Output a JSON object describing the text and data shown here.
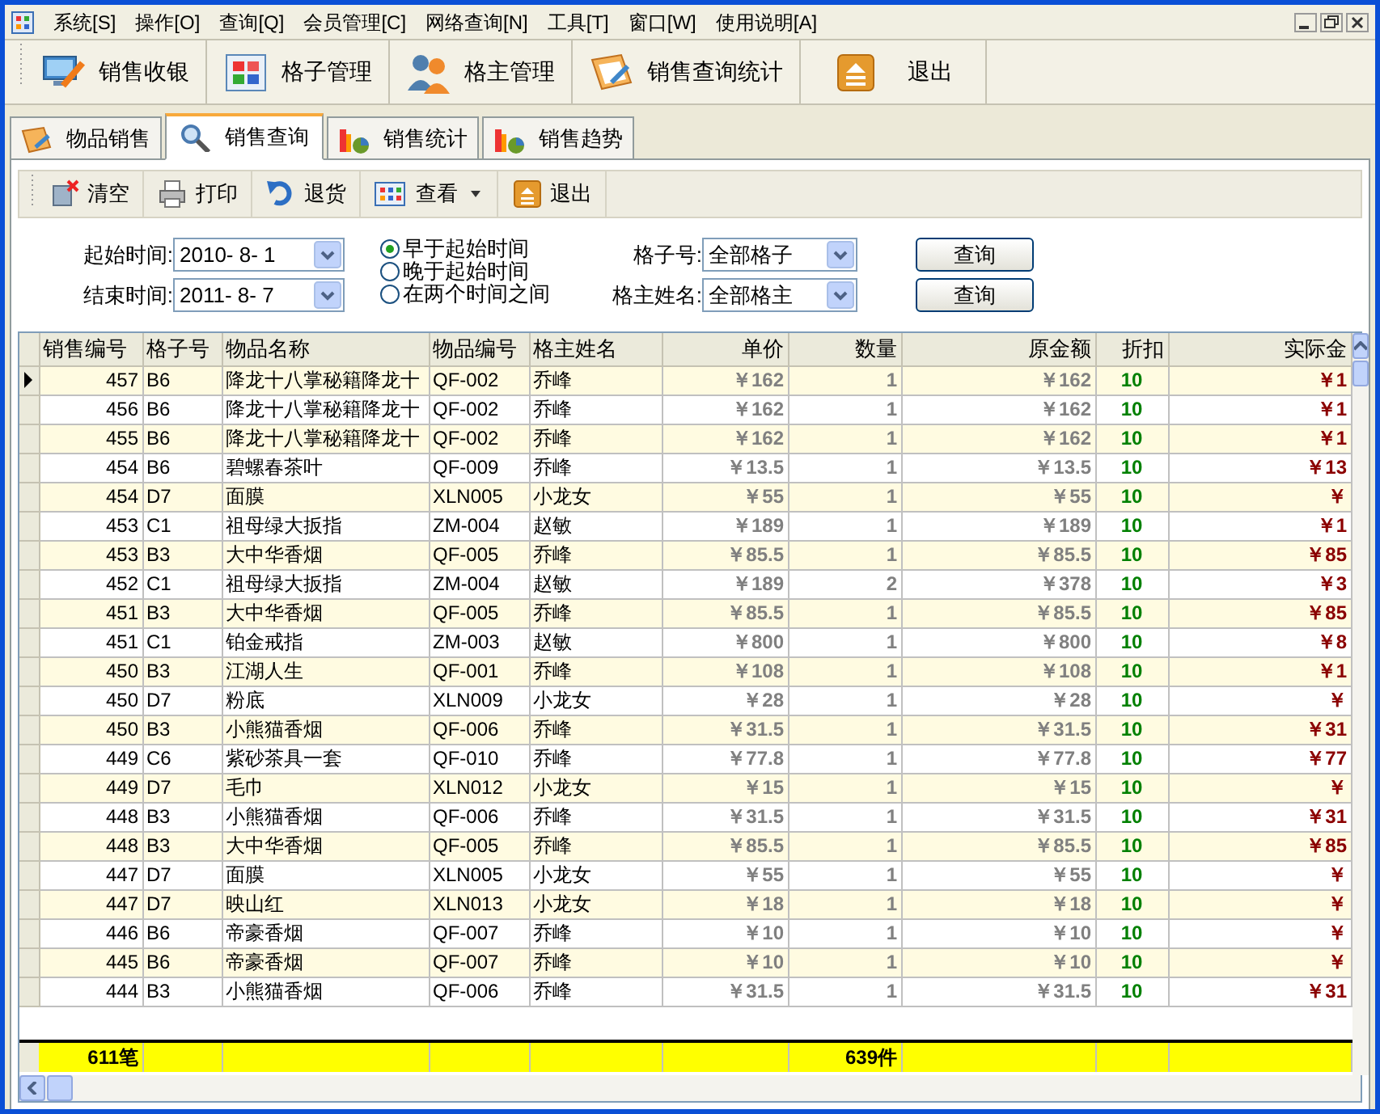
{
  "menu": [
    "系统[S]",
    "操作[O]",
    "查询[Q]",
    "会员管理[C]",
    "网络查询[N]",
    "工具[T]",
    "窗口[W]",
    "使用说明[A]"
  ],
  "toolbar": [
    "销售收银",
    "格子管理",
    "格主管理",
    "销售查询统计",
    "退出"
  ],
  "tabs": [
    {
      "label": "物品销售",
      "selected": false
    },
    {
      "label": "销售查询",
      "selected": true
    },
    {
      "label": "销售统计",
      "selected": false
    },
    {
      "label": "销售趋势",
      "selected": false
    }
  ],
  "sub_toolbar": [
    {
      "label": "清空",
      "dropdown": false
    },
    {
      "label": "打印",
      "dropdown": false
    },
    {
      "label": "退货",
      "dropdown": false
    },
    {
      "label": "查看",
      "dropdown": true
    },
    {
      "label": "退出",
      "dropdown": false
    }
  ],
  "filters": {
    "start_time": {
      "label": "起始时间:",
      "value": "2010- 8- 1"
    },
    "end_time": {
      "label": "结束时间:",
      "value": "2011- 8- 7"
    },
    "time_mode": [
      {
        "label": "早于起始时间",
        "selected": true
      },
      {
        "label": "晚于起始时间",
        "selected": false
      },
      {
        "label": "在两个时间之间",
        "selected": false
      }
    ],
    "cell_no": {
      "label": "格子号:",
      "value": "全部格子"
    },
    "owner_name": {
      "label": "格主姓名:",
      "value": "全部格主"
    },
    "buttons": [
      "查询",
      "查询"
    ]
  },
  "table": {
    "columns": [
      "销售编号",
      "格子号",
      "物品名称",
      "物品编号",
      "格主姓名",
      "单价",
      "数量",
      "原金额",
      "折扣",
      "实际金"
    ],
    "rows": [
      {
        "selected": true,
        "cells": [
          "457",
          "B6",
          "降龙十八掌秘籍降龙十",
          "QF-002",
          "乔峰",
          "￥162",
          "1",
          "￥162",
          "10",
          "￥1"
        ]
      },
      {
        "selected": false,
        "cells": [
          "456",
          "B6",
          "降龙十八掌秘籍降龙十",
          "QF-002",
          "乔峰",
          "￥162",
          "1",
          "￥162",
          "10",
          "￥1"
        ]
      },
      {
        "selected": false,
        "cells": [
          "455",
          "B6",
          "降龙十八掌秘籍降龙十",
          "QF-002",
          "乔峰",
          "￥162",
          "1",
          "￥162",
          "10",
          "￥1"
        ]
      },
      {
        "selected": false,
        "cells": [
          "454",
          "B6",
          "碧螺春茶叶",
          "QF-009",
          "乔峰",
          "￥13.5",
          "1",
          "￥13.5",
          "10",
          "￥13"
        ]
      },
      {
        "selected": false,
        "cells": [
          "454",
          "D7",
          "面膜",
          "XLN005",
          "小龙女",
          "￥55",
          "1",
          "￥55",
          "10",
          "￥"
        ]
      },
      {
        "selected": false,
        "cells": [
          "453",
          "C1",
          "祖母绿大扳指",
          "ZM-004",
          "赵敏",
          "￥189",
          "1",
          "￥189",
          "10",
          "￥1"
        ]
      },
      {
        "selected": false,
        "cells": [
          "453",
          "B3",
          "大中华香烟",
          "QF-005",
          "乔峰",
          "￥85.5",
          "1",
          "￥85.5",
          "10",
          "￥85"
        ]
      },
      {
        "selected": false,
        "cells": [
          "452",
          "C1",
          "祖母绿大扳指",
          "ZM-004",
          "赵敏",
          "￥189",
          "2",
          "￥378",
          "10",
          "￥3"
        ]
      },
      {
        "selected": false,
        "cells": [
          "451",
          "B3",
          "大中华香烟",
          "QF-005",
          "乔峰",
          "￥85.5",
          "1",
          "￥85.5",
          "10",
          "￥85"
        ]
      },
      {
        "selected": false,
        "cells": [
          "451",
          "C1",
          "铂金戒指",
          "ZM-003",
          "赵敏",
          "￥800",
          "1",
          "￥800",
          "10",
          "￥8"
        ]
      },
      {
        "selected": false,
        "cells": [
          "450",
          "B3",
          "江湖人生",
          "QF-001",
          "乔峰",
          "￥108",
          "1",
          "￥108",
          "10",
          "￥1"
        ]
      },
      {
        "selected": false,
        "cells": [
          "450",
          "D7",
          "粉底",
          "XLN009",
          "小龙女",
          "￥28",
          "1",
          "￥28",
          "10",
          "￥"
        ]
      },
      {
        "selected": false,
        "cells": [
          "450",
          "B3",
          "小熊猫香烟",
          "QF-006",
          "乔峰",
          "￥31.5",
          "1",
          "￥31.5",
          "10",
          "￥31"
        ]
      },
      {
        "selected": false,
        "cells": [
          "449",
          "C6",
          "紫砂茶具一套",
          "QF-010",
          "乔峰",
          "￥77.8",
          "1",
          "￥77.8",
          "10",
          "￥77"
        ]
      },
      {
        "selected": false,
        "cells": [
          "449",
          "D7",
          "毛巾",
          "XLN012",
          "小龙女",
          "￥15",
          "1",
          "￥15",
          "10",
          "￥"
        ]
      },
      {
        "selected": false,
        "cells": [
          "448",
          "B3",
          "小熊猫香烟",
          "QF-006",
          "乔峰",
          "￥31.5",
          "1",
          "￥31.5",
          "10",
          "￥31"
        ]
      },
      {
        "selected": false,
        "cells": [
          "448",
          "B3",
          "大中华香烟",
          "QF-005",
          "乔峰",
          "￥85.5",
          "1",
          "￥85.5",
          "10",
          "￥85"
        ]
      },
      {
        "selected": false,
        "cells": [
          "447",
          "D7",
          "面膜",
          "XLN005",
          "小龙女",
          "￥55",
          "1",
          "￥55",
          "10",
          "￥"
        ]
      },
      {
        "selected": false,
        "cells": [
          "447",
          "D7",
          "映山红",
          "XLN013",
          "小龙女",
          "￥18",
          "1",
          "￥18",
          "10",
          "￥"
        ]
      },
      {
        "selected": false,
        "cells": [
          "446",
          "B6",
          "帝豪香烟",
          "QF-007",
          "乔峰",
          "￥10",
          "1",
          "￥10",
          "10",
          "￥"
        ]
      },
      {
        "selected": false,
        "cells": [
          "445",
          "B6",
          "帝豪香烟",
          "QF-007",
          "乔峰",
          "￥10",
          "1",
          "￥10",
          "10",
          "￥"
        ]
      },
      {
        "selected": false,
        "cells": [
          "444",
          "B3",
          "小熊猫香烟",
          "QF-006",
          "乔峰",
          "￥31.5",
          "1",
          "￥31.5",
          "10",
          "￥31"
        ]
      }
    ],
    "footer": {
      "count": "611笔",
      "quantity": "639件"
    }
  }
}
